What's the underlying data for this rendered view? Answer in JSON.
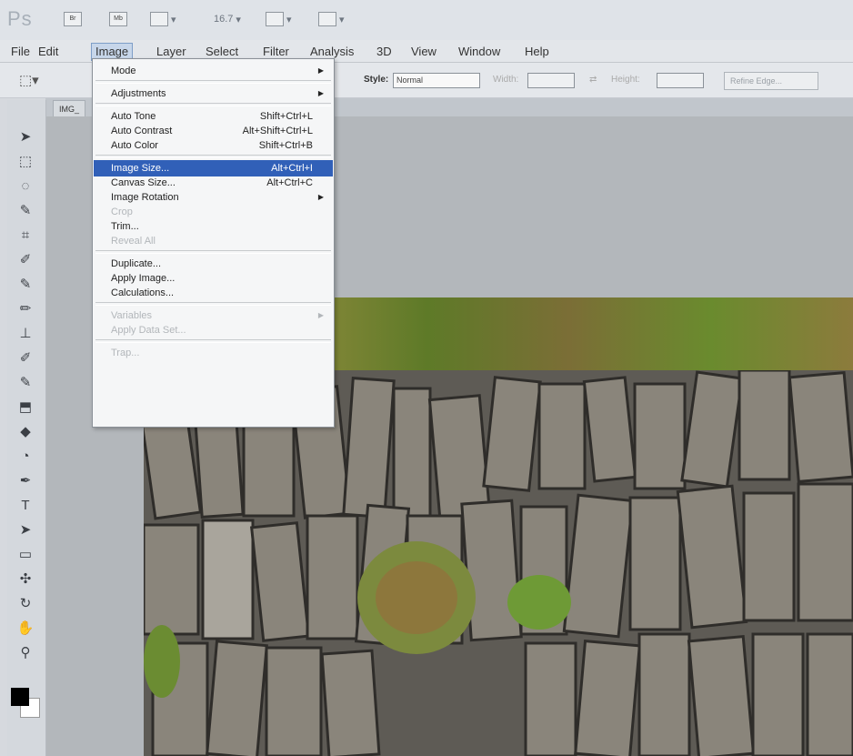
{
  "app": {
    "logo": "Ps",
    "zoom": "16.7",
    "colors": {
      "accent": "#3160b8",
      "chrome": "#dfe3e8"
    }
  },
  "menubar": [
    "File",
    "Edit",
    "Image",
    "Layer",
    "Select",
    "Filter",
    "Analysis",
    "3D",
    "View",
    "Window",
    "Help"
  ],
  "options": {
    "style_label": "Style:",
    "style_value": "Normal",
    "width_label": "Width:",
    "height_label": "Height:",
    "refine_edge": "Refine Edge..."
  },
  "document": {
    "tab": "IMG_"
  },
  "image_menu": [
    {
      "label": "Mode",
      "shortcut": "",
      "submenu": true,
      "enabled": true
    },
    {
      "sep": true
    },
    {
      "label": "Adjustments",
      "shortcut": "",
      "submenu": true,
      "enabled": true
    },
    {
      "sep": true
    },
    {
      "label": "Auto Tone",
      "shortcut": "Shift+Ctrl+L",
      "enabled": true
    },
    {
      "label": "Auto Contrast",
      "shortcut": "Alt+Shift+Ctrl+L",
      "enabled": true
    },
    {
      "label": "Auto Color",
      "shortcut": "Shift+Ctrl+B",
      "enabled": true
    },
    {
      "sep": true
    },
    {
      "label": "Image Size...",
      "shortcut": "Alt+Ctrl+I",
      "enabled": true,
      "selected": true
    },
    {
      "label": "Canvas Size...",
      "shortcut": "Alt+Ctrl+C",
      "enabled": true
    },
    {
      "label": "Image Rotation",
      "shortcut": "",
      "submenu": true,
      "enabled": true
    },
    {
      "label": "Crop",
      "shortcut": "",
      "enabled": false
    },
    {
      "label": "Trim...",
      "shortcut": "",
      "enabled": true
    },
    {
      "label": "Reveal All",
      "shortcut": "",
      "enabled": false
    },
    {
      "sep": true
    },
    {
      "label": "Duplicate...",
      "shortcut": "",
      "enabled": true
    },
    {
      "label": "Apply Image...",
      "shortcut": "",
      "enabled": true
    },
    {
      "label": "Calculations...",
      "shortcut": "",
      "enabled": true
    },
    {
      "sep": true
    },
    {
      "label": "Variables",
      "shortcut": "",
      "submenu": true,
      "enabled": false
    },
    {
      "label": "Apply Data Set...",
      "shortcut": "",
      "enabled": false
    },
    {
      "sep": true
    },
    {
      "label": "Trap...",
      "shortcut": "",
      "enabled": false
    }
  ]
}
